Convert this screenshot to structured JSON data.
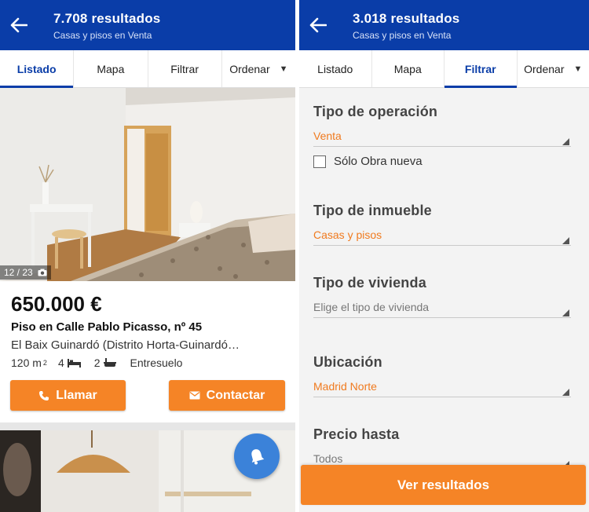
{
  "left": {
    "header": {
      "title": "7.708 resultados",
      "subtitle": "Casas y pisos en Venta"
    },
    "tabs": [
      {
        "label": "Listado",
        "active": true
      },
      {
        "label": "Mapa"
      },
      {
        "label": "Filtrar"
      },
      {
        "label": "Ordenar",
        "dropdown": true
      }
    ],
    "listing": {
      "photo_counter": "12 / 23",
      "price": "650.000 €",
      "title": "Piso en Calle Pablo Picasso, nº 45",
      "address": "El Baix Guinardó (Distrito Horta-Guinardó…",
      "area": "120 m",
      "area_sup": "2",
      "rooms": "4",
      "baths": "2",
      "floor": "Entresuelo",
      "call_label": "Llamar",
      "contact_label": "Contactar"
    }
  },
  "right": {
    "header": {
      "title": "3.018 resultados",
      "subtitle": "Casas y pisos en Venta"
    },
    "tabs": [
      {
        "label": "Listado"
      },
      {
        "label": "Mapa"
      },
      {
        "label": "Filtrar",
        "active": true
      },
      {
        "label": "Ordenar",
        "dropdown": true
      }
    ],
    "filters": {
      "operation": {
        "label": "Tipo de operación",
        "value": "Venta",
        "checkbox_label": "Sólo Obra nueva",
        "checked": false
      },
      "property": {
        "label": "Tipo de inmueble",
        "value": "Casas y pisos"
      },
      "housing": {
        "label": "Tipo de vivienda",
        "placeholder": "Elige el tipo de vivienda"
      },
      "location": {
        "label": "Ubicación",
        "value": "Madrid Norte"
      },
      "price": {
        "label": "Precio hasta",
        "value": "Todos"
      }
    },
    "cta_label": "Ver resultados"
  },
  "colors": {
    "brand_blue": "#0a3da8",
    "accent_orange": "#f58426",
    "fab_blue": "#3b82d9"
  }
}
